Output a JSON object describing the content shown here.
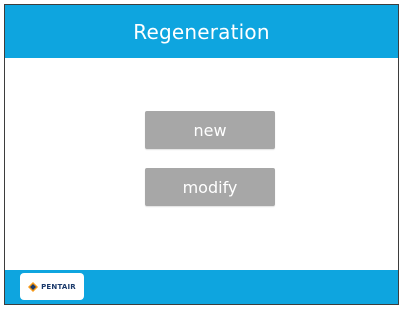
{
  "header": {
    "title": "Regeneration"
  },
  "actions": {
    "new_label": "new",
    "modify_label": "modify"
  },
  "footer": {
    "logo_text": "PENTAIR"
  },
  "colors": {
    "header_bg": "#0ea5df",
    "footer_bg": "#0ea5df",
    "button_bg": "#a7a7a7",
    "logo_text": "#1b3a6b"
  }
}
